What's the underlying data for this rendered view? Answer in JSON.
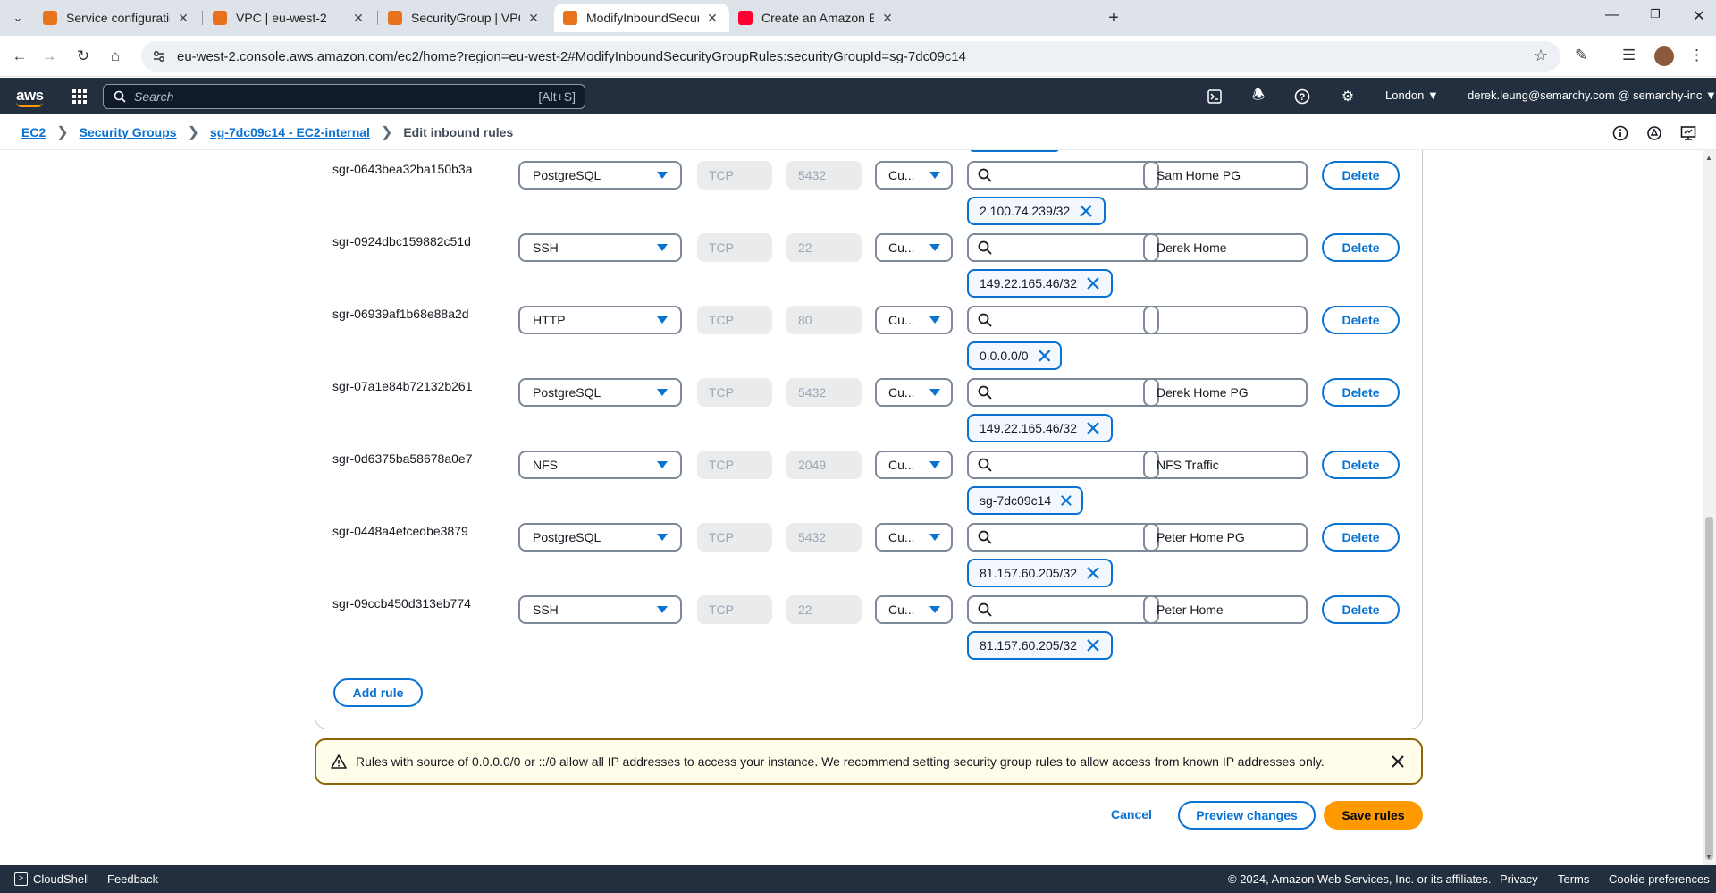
{
  "browser": {
    "tabs": [
      {
        "title": "Service configuration | Elastic C",
        "fav_color": "#e7731d",
        "active": false
      },
      {
        "title": "VPC | eu-west-2",
        "fav_color": "#e8711d",
        "active": false
      },
      {
        "title": "SecurityGroup | VPC Console",
        "fav_color": "#e8711d",
        "active": false
      },
      {
        "title": "ModifyInboundSecurityGroupR",
        "fav_color": "#e7731d",
        "active": true
      },
      {
        "title": "Create an Amazon EFS Filesyste",
        "fav_color": "#ff0033",
        "active": false
      }
    ],
    "url": "eu-west-2.console.aws.amazon.com/ec2/home?region=eu-west-2#ModifyInboundSecurityGroupRules:securityGroupId=sg-7dc09c14"
  },
  "aws_nav": {
    "logo": "aws",
    "search_placeholder": "Search",
    "search_shortcut": "[Alt+S]",
    "region": "London",
    "account": "derek.leung@semarchy.com @ semarchy-inc"
  },
  "breadcrumb": {
    "items": [
      "EC2",
      "Security Groups",
      "sg-7dc09c14 - EC2-internal"
    ],
    "current": "Edit inbound rules"
  },
  "rules": [
    {
      "id": "sgr-0643bea32ba150b3a",
      "type": "PostgreSQL",
      "protocol": "TCP",
      "port": "5432",
      "source_type": "Cu...",
      "source": "2.100.74.239/32",
      "description": "Sam Home PG"
    },
    {
      "id": "sgr-0924dbc159882c51d",
      "type": "SSH",
      "protocol": "TCP",
      "port": "22",
      "source_type": "Cu...",
      "source": "149.22.165.46/32",
      "description": "Derek Home"
    },
    {
      "id": "sgr-06939af1b68e88a2d",
      "type": "HTTP",
      "protocol": "TCP",
      "port": "80",
      "source_type": "Cu...",
      "source": "0.0.0.0/0",
      "description": ""
    },
    {
      "id": "sgr-07a1e84b72132b261",
      "type": "PostgreSQL",
      "protocol": "TCP",
      "port": "5432",
      "source_type": "Cu...",
      "source": "149.22.165.46/32",
      "description": "Derek Home PG"
    },
    {
      "id": "sgr-0d6375ba58678a0e7",
      "type": "NFS",
      "protocol": "TCP",
      "port": "2049",
      "source_type": "Cu...",
      "source": "sg-7dc09c14",
      "description": "NFS Traffic"
    },
    {
      "id": "sgr-0448a4efcedbe3879",
      "type": "PostgreSQL",
      "protocol": "TCP",
      "port": "5432",
      "source_type": "Cu...",
      "source": "81.157.60.205/32",
      "description": "Peter Home PG"
    },
    {
      "id": "sgr-09ccb450d313eb774",
      "type": "SSH",
      "protocol": "TCP",
      "port": "22",
      "source_type": "Cu...",
      "source": "81.157.60.205/32",
      "description": "Peter Home"
    }
  ],
  "buttons": {
    "delete": "Delete",
    "add_rule": "Add rule",
    "cancel": "Cancel",
    "preview": "Preview changes",
    "save": "Save rules"
  },
  "alert": {
    "text": "Rules with source of 0.0.0.0/0 or ::/0 allow all IP addresses to access your instance. We recommend setting security group rules to allow access from known IP addresses only."
  },
  "footer": {
    "cloudshell": "CloudShell",
    "feedback": "Feedback",
    "copyright": "© 2024, Amazon Web Services, Inc. or its affiliates.",
    "privacy": "Privacy",
    "terms": "Terms",
    "cookies": "Cookie preferences"
  },
  "colors": {
    "accent": "#0972d3",
    "save": "#ff9900",
    "nav_bg": "#232f3e",
    "warning_border": "#8d6605"
  }
}
